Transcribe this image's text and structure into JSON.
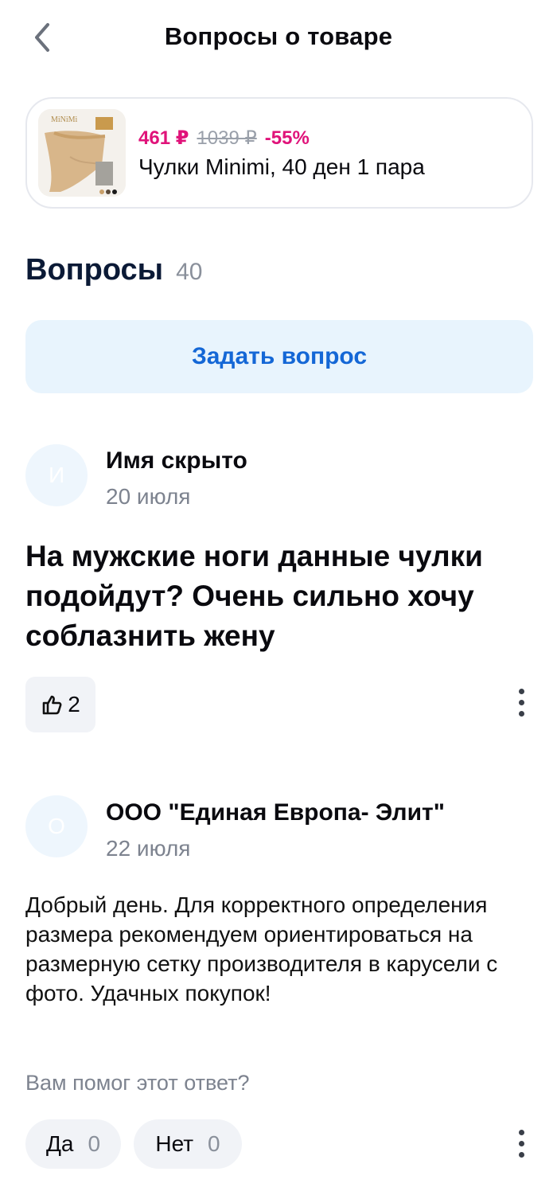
{
  "header": {
    "title": "Вопросы о товаре"
  },
  "product": {
    "price_now": "461 ₽",
    "price_old": "1039 ₽",
    "discount": "-55%",
    "name": "Чулки Minimi, 40 ден 1 пара",
    "image_brand": "MiNiMi"
  },
  "questions_section": {
    "title": "Вопросы",
    "count": "40"
  },
  "ask_button": {
    "label": "Задать вопрос"
  },
  "question": {
    "avatar_letter": "И",
    "author": "Имя скрыто",
    "date": "20 июля",
    "text": "На мужские ноги данные чулки подойдут? Очень сильно хочу соблазнить жену",
    "likes": "2"
  },
  "answer": {
    "avatar_letter": "О",
    "author": "ООО \"Единая Европа- Элит\"",
    "date": "22 июля",
    "text": "Добрый день. Для корректного определения размера рекомендуем ориентироваться на размерную сетку производителя в карусели с фото. Удачных покупок!",
    "helpful_prompt": "Вам помог этот ответ?",
    "yes_label": "Да",
    "yes_count": "0",
    "no_label": "Нет",
    "no_count": "0"
  },
  "colors": {
    "accent": "#1467d6",
    "price": "#e0137a",
    "ask_bg": "#e8f4fd"
  }
}
